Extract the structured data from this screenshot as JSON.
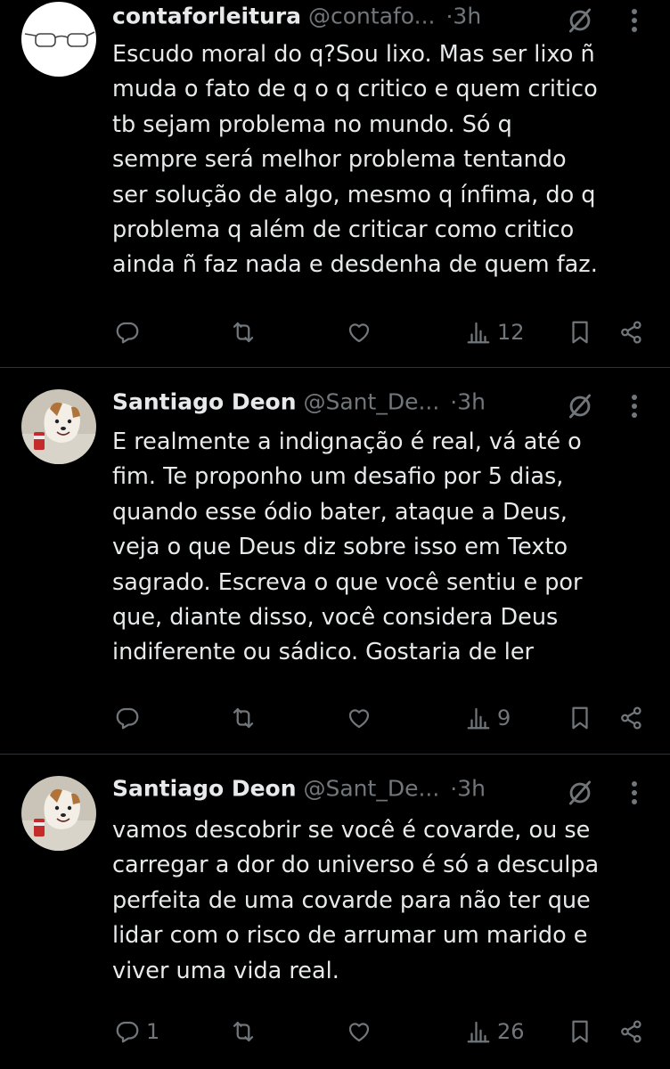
{
  "tweets": [
    {
      "author": "contaforleitura",
      "handle": "@contafo...",
      "separator": "·",
      "time": "3h",
      "avatar_icon": "glasses-avatar-icon",
      "text": "Escudo moral do q?Sou lixo. Mas ser lixo ñ\nmuda o fato de q o q critico e quem critico\ntb sejam problema no mundo. Só q\nsempre será melhor problema tentando\nser solução de algo, mesmo q ínfima, do q\nproblema q além de criticar como critico\nainda ñ faz nada e desdenha de quem faz.",
      "replies": "",
      "retweets": "",
      "likes": "",
      "views": "12"
    },
    {
      "author": "Santiago Deon",
      "handle": "@Sant_De...",
      "separator": "·",
      "time": "3h",
      "avatar_icon": "dog-avatar-icon",
      "text": "E realmente a indignação é real, vá até o\nfim. Te proponho um desafio por 5 dias,\nquando esse ódio bater, ataque a Deus,\nveja o que Deus diz sobre isso em Texto\nsagrado. Escreva o que você sentiu e por\nque, diante disso, você considera Deus\nindiferente ou sádico. Gostaria de ler",
      "replies": "",
      "retweets": "",
      "likes": "",
      "views": "9"
    },
    {
      "author": "Santiago Deon",
      "handle": "@Sant_De...",
      "separator": "·",
      "time": "3h",
      "avatar_icon": "dog-avatar-icon",
      "text": "vamos descobrir se você é covarde, ou se\ncarregar a dor do universo é só a desculpa\nperfeita de uma covarde para não ter que\nlidar com o risco de arrumar um marido e\nviver uma vida real.",
      "replies": "1",
      "retweets": "",
      "likes": "",
      "views": "26"
    }
  ],
  "colors": {
    "background": "#000000",
    "text": "#e7e9ea",
    "muted": "#71767b",
    "divider": "#2f3336"
  }
}
